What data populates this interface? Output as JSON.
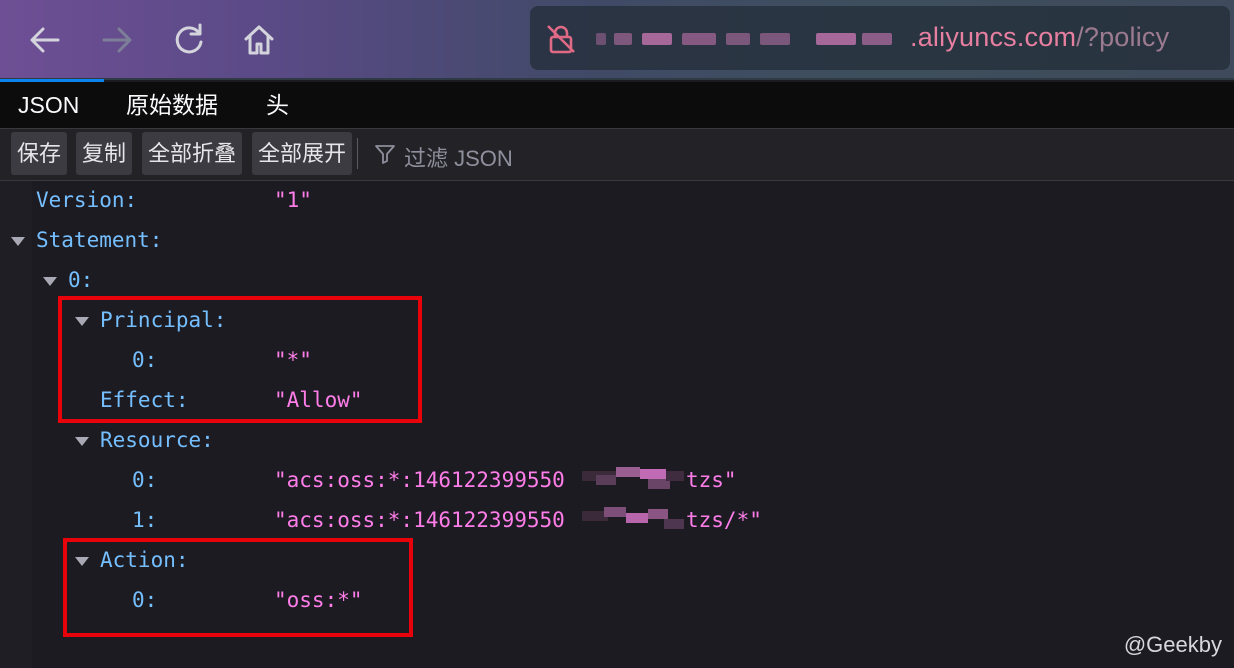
{
  "browser": {
    "url_domain": ".aliyuncs.com",
    "url_path": "/?policy",
    "nav": [
      "back-icon",
      "forward-icon",
      "reload-icon",
      "home-icon"
    ]
  },
  "viewer_tabs": [
    "JSON",
    "原始数据",
    "头"
  ],
  "actions": {
    "save": "保存",
    "copy": "复制",
    "collapse_all": "全部折叠",
    "expand_all": "全部展开",
    "filter_placeholder": "过滤 JSON"
  },
  "json": {
    "version_key": "Version:",
    "version_val": "\"1\"",
    "statement_key": "Statement:",
    "index0_key": "0:",
    "principal_key": "Principal:",
    "principal0_key": "0:",
    "principal0_val": "\"*\"",
    "effect_key": "Effect:",
    "effect_val": "\"Allow\"",
    "resource_key": "Resource:",
    "resource0_key": "0:",
    "resource0_val_start": "\"acs:oss:*:146122399550",
    "resource0_val_end": "tzs\"",
    "resource1_key": "1:",
    "resource1_val_start": "\"acs:oss:*:146122399550",
    "resource1_val_end": "tzs/*\"",
    "action_key": "Action:",
    "action0_key": "0:",
    "action0_val": "\"oss:*\""
  },
  "watermark": "@Geekby",
  "colors": {
    "key": "#75bfff",
    "string": "#ff7de9",
    "highlight_box": "#e8030b"
  }
}
